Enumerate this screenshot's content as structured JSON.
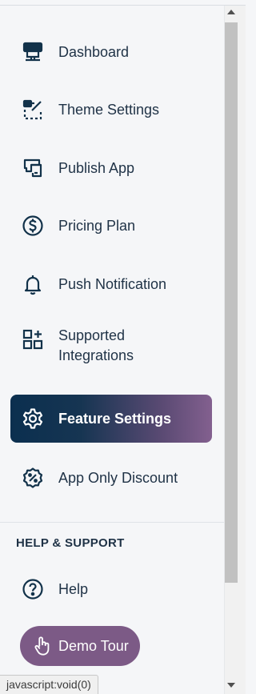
{
  "nav": {
    "items": [
      {
        "label": "Dashboard",
        "icon": "dashboard-icon"
      },
      {
        "label": "Theme Settings",
        "icon": "theme-settings-icon"
      },
      {
        "label": "Publish App",
        "icon": "publish-app-icon"
      },
      {
        "label": "Pricing Plan",
        "icon": "dollar-circle-icon"
      },
      {
        "label": "Push Notification",
        "icon": "bell-icon"
      },
      {
        "label": "Supported Integrations",
        "label_line1": "Supported",
        "label_line2": "Integrations",
        "icon": "integrations-icon"
      },
      {
        "label": "Feature Settings",
        "icon": "gear-icon",
        "active": true
      },
      {
        "label": "App Only Discount",
        "icon": "discount-badge-icon"
      }
    ]
  },
  "help_section": {
    "title": "HELP & SUPPORT",
    "help_label": "Help",
    "demo_tour_label": "Demo Tour"
  },
  "status_bar": {
    "url": "javascript:void(0)"
  },
  "colors": {
    "active_gradient_start": "#0b2f4f",
    "active_gradient_end": "#83608f",
    "demo_button": "#7c5a86",
    "icon_color": "#12324a"
  }
}
